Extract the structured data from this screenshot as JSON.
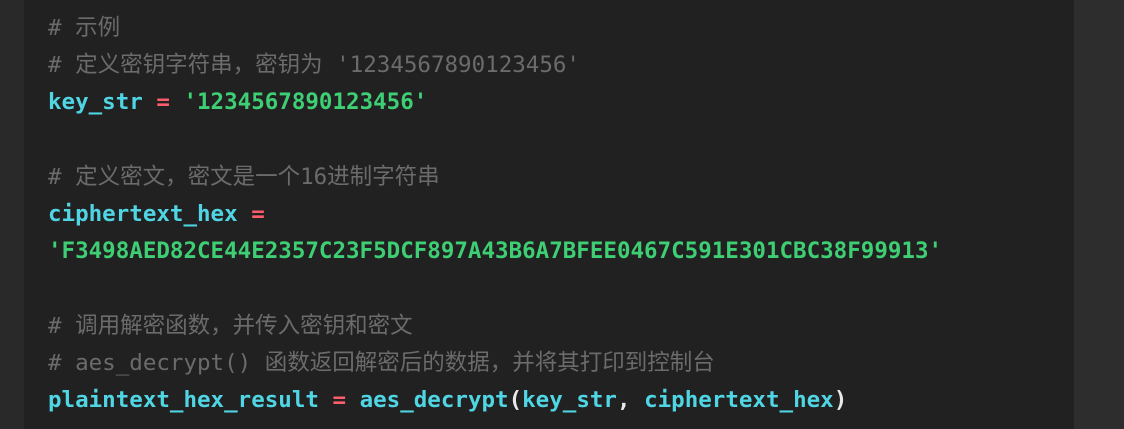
{
  "editor": {
    "code_lines": [
      {
        "type": "comment",
        "text": "# 示例"
      },
      {
        "type": "comment",
        "text": "# 定义密钥字符串，密钥为 '1234567890123456'"
      },
      {
        "type": "assignment",
        "var": "key_str",
        "op": " = ",
        "value": "'1234567890123456'"
      },
      {
        "type": "blank",
        "text": ""
      },
      {
        "type": "comment",
        "text": "# 定义密文，密文是一个16进制字符串"
      },
      {
        "type": "assignment_start",
        "var": "ciphertext_hex",
        "op": " ="
      },
      {
        "type": "string",
        "value": "'F3498AED82CE44E2357C23F5DCF897A43B6A7BFEE0467C591E301CBC38F99913'"
      },
      {
        "type": "blank",
        "text": ""
      },
      {
        "type": "comment",
        "text": "# 调用解密函数，并传入密钥和密文"
      },
      {
        "type": "comment",
        "text": "# aes_decrypt() 函数返回解密后的数据，并将其打印到控制台"
      },
      {
        "type": "call",
        "var": "plaintext_hex_result",
        "op": " = ",
        "func": "aes_decrypt",
        "open": "(",
        "arg1": "key_str",
        "comma": ", ",
        "arg2": "ciphertext_hex",
        "close": ")"
      }
    ]
  },
  "colors": {
    "background": "#292929",
    "panel": "#212121",
    "comment": "#6b6b6b",
    "identifier": "#4fd5e3",
    "operator": "#ff5c6c",
    "string": "#3ecf74"
  }
}
